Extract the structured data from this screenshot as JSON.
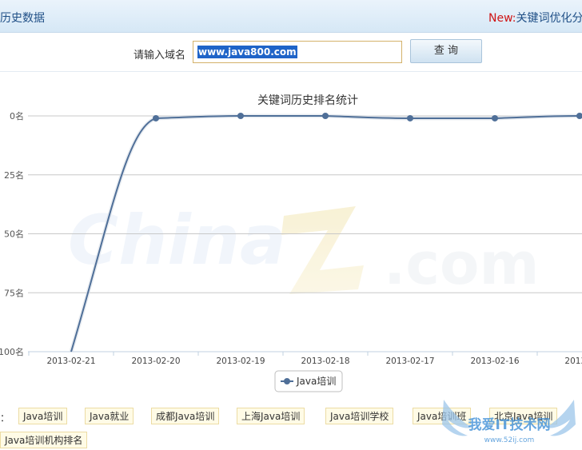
{
  "header": {
    "title": "历史数据",
    "news_prefix": "New:",
    "news_text": "关键词优化分"
  },
  "search": {
    "label": "请输入域名",
    "value": "www.java800.com",
    "button_label": "查 询"
  },
  "colors": {
    "series": "#4f6f98",
    "axis": "#c0c0c0",
    "header_text": "#1f4f86",
    "news_red": "#d01515"
  },
  "chart_data": {
    "type": "line",
    "title": "关键词历史排名统计",
    "x": [
      "2013-02-21",
      "2013-02-20",
      "2013-02-19",
      "2013-02-18",
      "2013-02-17",
      "2013-02-16",
      "2013-0"
    ],
    "series": [
      {
        "name": "Java培训",
        "values": [
          100,
          1,
          0,
          0,
          1,
          1,
          0
        ]
      }
    ],
    "y_tick_labels": [
      "0名",
      "25名",
      "50名",
      "75名",
      "100名"
    ],
    "y_ticks": [
      0,
      25,
      50,
      75,
      100
    ],
    "ylim": [
      0,
      100
    ],
    "y_inverted": true,
    "grid": true,
    "legend": "bottom-center"
  },
  "tags": {
    "prefix": "：",
    "items": [
      "Java培训",
      "Java就业",
      "成都Java培训",
      "上海Java培训",
      "Java培训学校",
      "Java培训班",
      "北京Java培训",
      "Java培训机构排名"
    ]
  },
  "watermark": {
    "text": "我爱IT技术网",
    "url": "www.52ij.com"
  }
}
